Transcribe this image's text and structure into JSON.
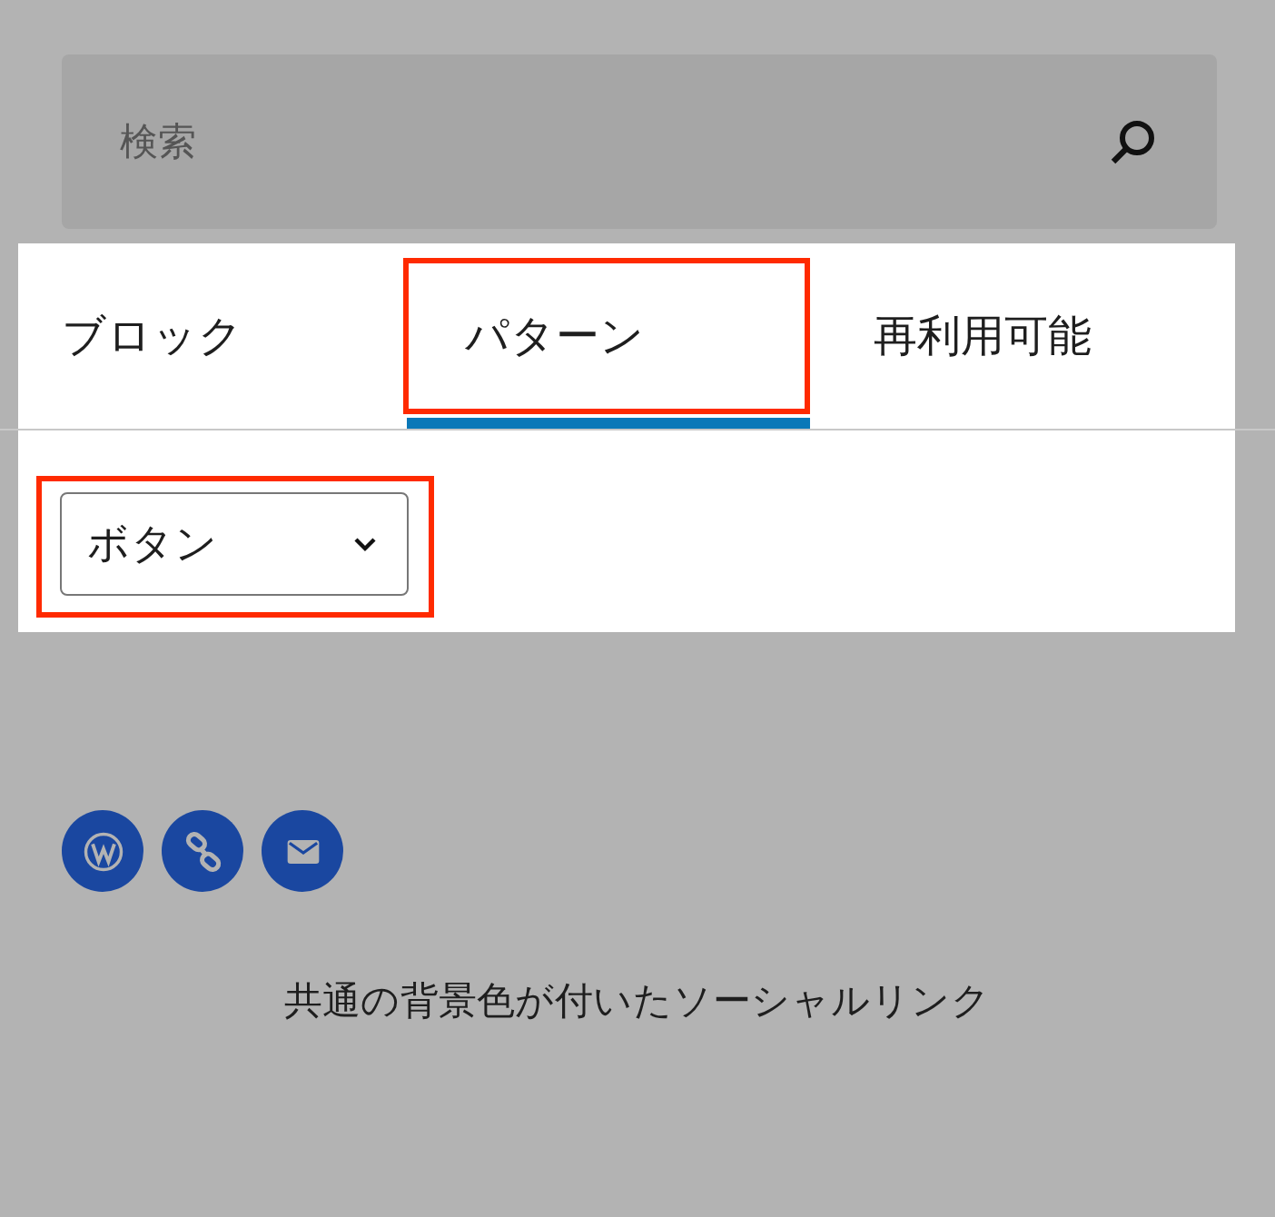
{
  "search": {
    "placeholder": "検索"
  },
  "tabs": [
    {
      "label": "ブロック",
      "selected": false,
      "highlighted": false
    },
    {
      "label": "パターン",
      "selected": true,
      "highlighted": true
    },
    {
      "label": "再利用可能",
      "selected": false,
      "highlighted": false
    }
  ],
  "category_select": {
    "value": "ボタン",
    "highlighted": true
  },
  "social_links": [
    {
      "kind": "wordpress",
      "color": "#1a47a0"
    },
    {
      "kind": "link",
      "color": "#1a47a0"
    },
    {
      "kind": "mail",
      "color": "#1a47a0"
    }
  ],
  "pattern_caption": "共通の背景色が付いたソーシャルリンク"
}
